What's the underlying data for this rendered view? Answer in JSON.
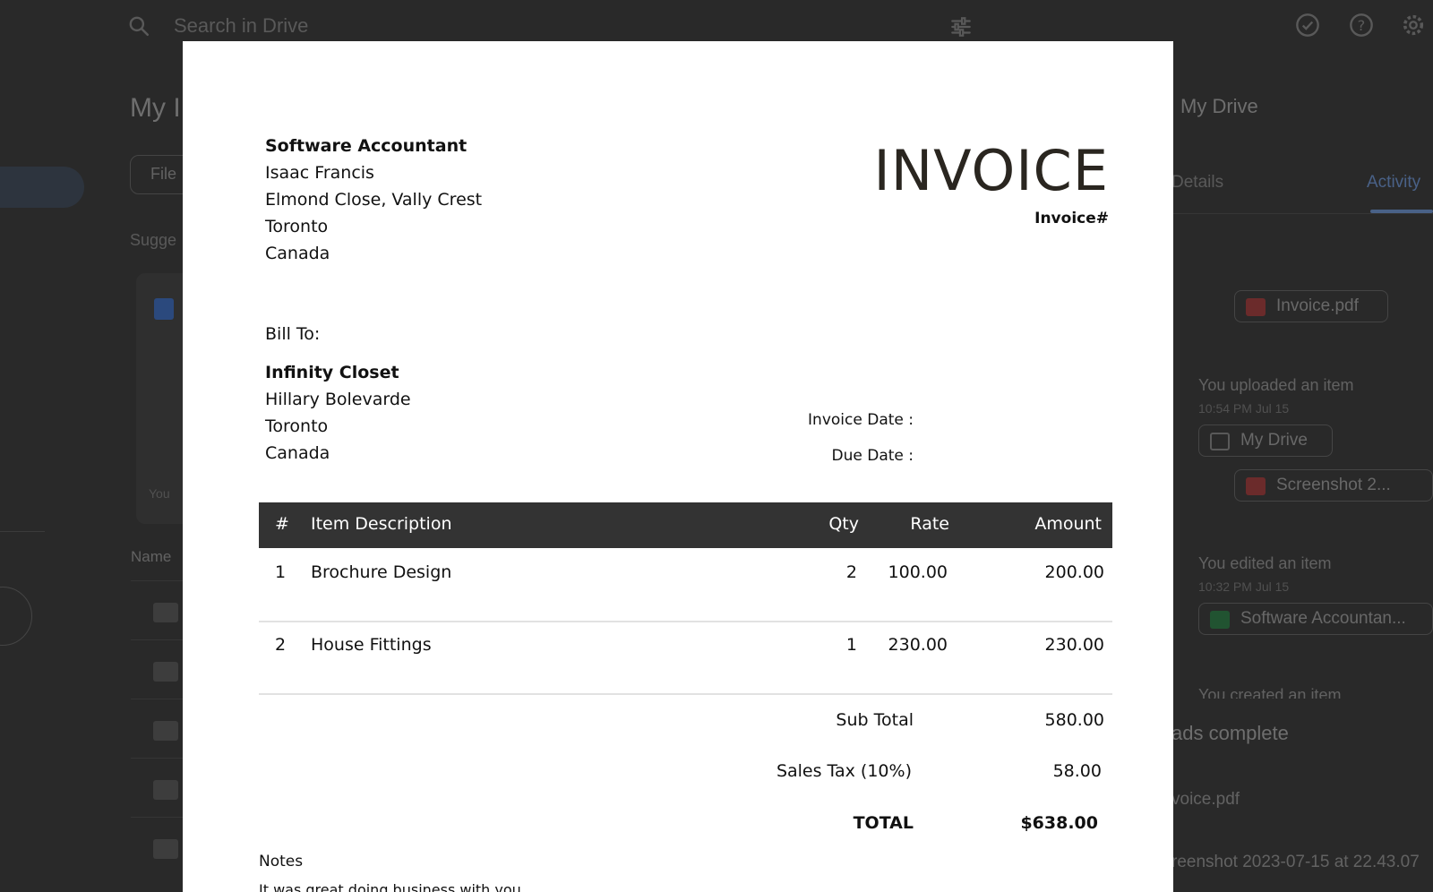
{
  "drive": {
    "search_placeholder": "Search in Drive",
    "page_title": "My I",
    "filter_chip": "File",
    "suggested": "Sugge",
    "you_label": "You",
    "name_header": "Name",
    "right_panel": {
      "title": "My Drive",
      "tabs": [
        "Details",
        "Activity"
      ],
      "events": [
        {
          "text": "You uploaded an item",
          "time": "10:54 PM Jul 15"
        },
        {
          "text": "You edited an item",
          "time": "10:32 PM Jul 15"
        },
        {
          "text": "You created an item",
          "time": ""
        }
      ],
      "chips": [
        "Invoice.pdf",
        "My Drive",
        "Screenshot 2...",
        "Software Accountan..."
      ],
      "uploads_title": "ads complete",
      "uploads": [
        "voice.pdf",
        "reenshot 2023-07-15 at 22.43.07"
      ]
    },
    "colors": {
      "accent": "#7fa7e8",
      "pdf_red": "#d9534f",
      "sheets_green": "#34a853"
    }
  },
  "invoice": {
    "from": {
      "company": "Software Accountant",
      "name": "Isaac Francis",
      "street": "Elmond Close, Vally Crest",
      "city": "Toronto",
      "country": "Canada"
    },
    "title": "INVOICE",
    "number_label": "Invoice#",
    "bill_to_label": "Bill To:",
    "to": {
      "company": "Infinity Closet",
      "street": "Hillary Bolevarde",
      "city": "Toronto",
      "country": "Canada"
    },
    "invoice_date_label": "Invoice Date :",
    "due_date_label": "Due Date :",
    "columns": {
      "num": "#",
      "desc": "Item Description",
      "qty": "Qty",
      "rate": "Rate",
      "amount": "Amount"
    },
    "items": [
      {
        "num": "1",
        "desc": "Brochure Design",
        "qty": "2",
        "rate": "100.00",
        "amount": "200.00"
      },
      {
        "num": "2",
        "desc": "House Fittings",
        "qty": "1",
        "rate": "230.00",
        "amount": "230.00"
      }
    ],
    "subtotal_label": "Sub Total",
    "subtotal": "580.00",
    "tax_label": "Sales Tax (10%)",
    "tax": "58.00",
    "total_label": "TOTAL",
    "total": "$638.00",
    "notes_label": "Notes",
    "notes_text": "It was great doing business with you."
  }
}
